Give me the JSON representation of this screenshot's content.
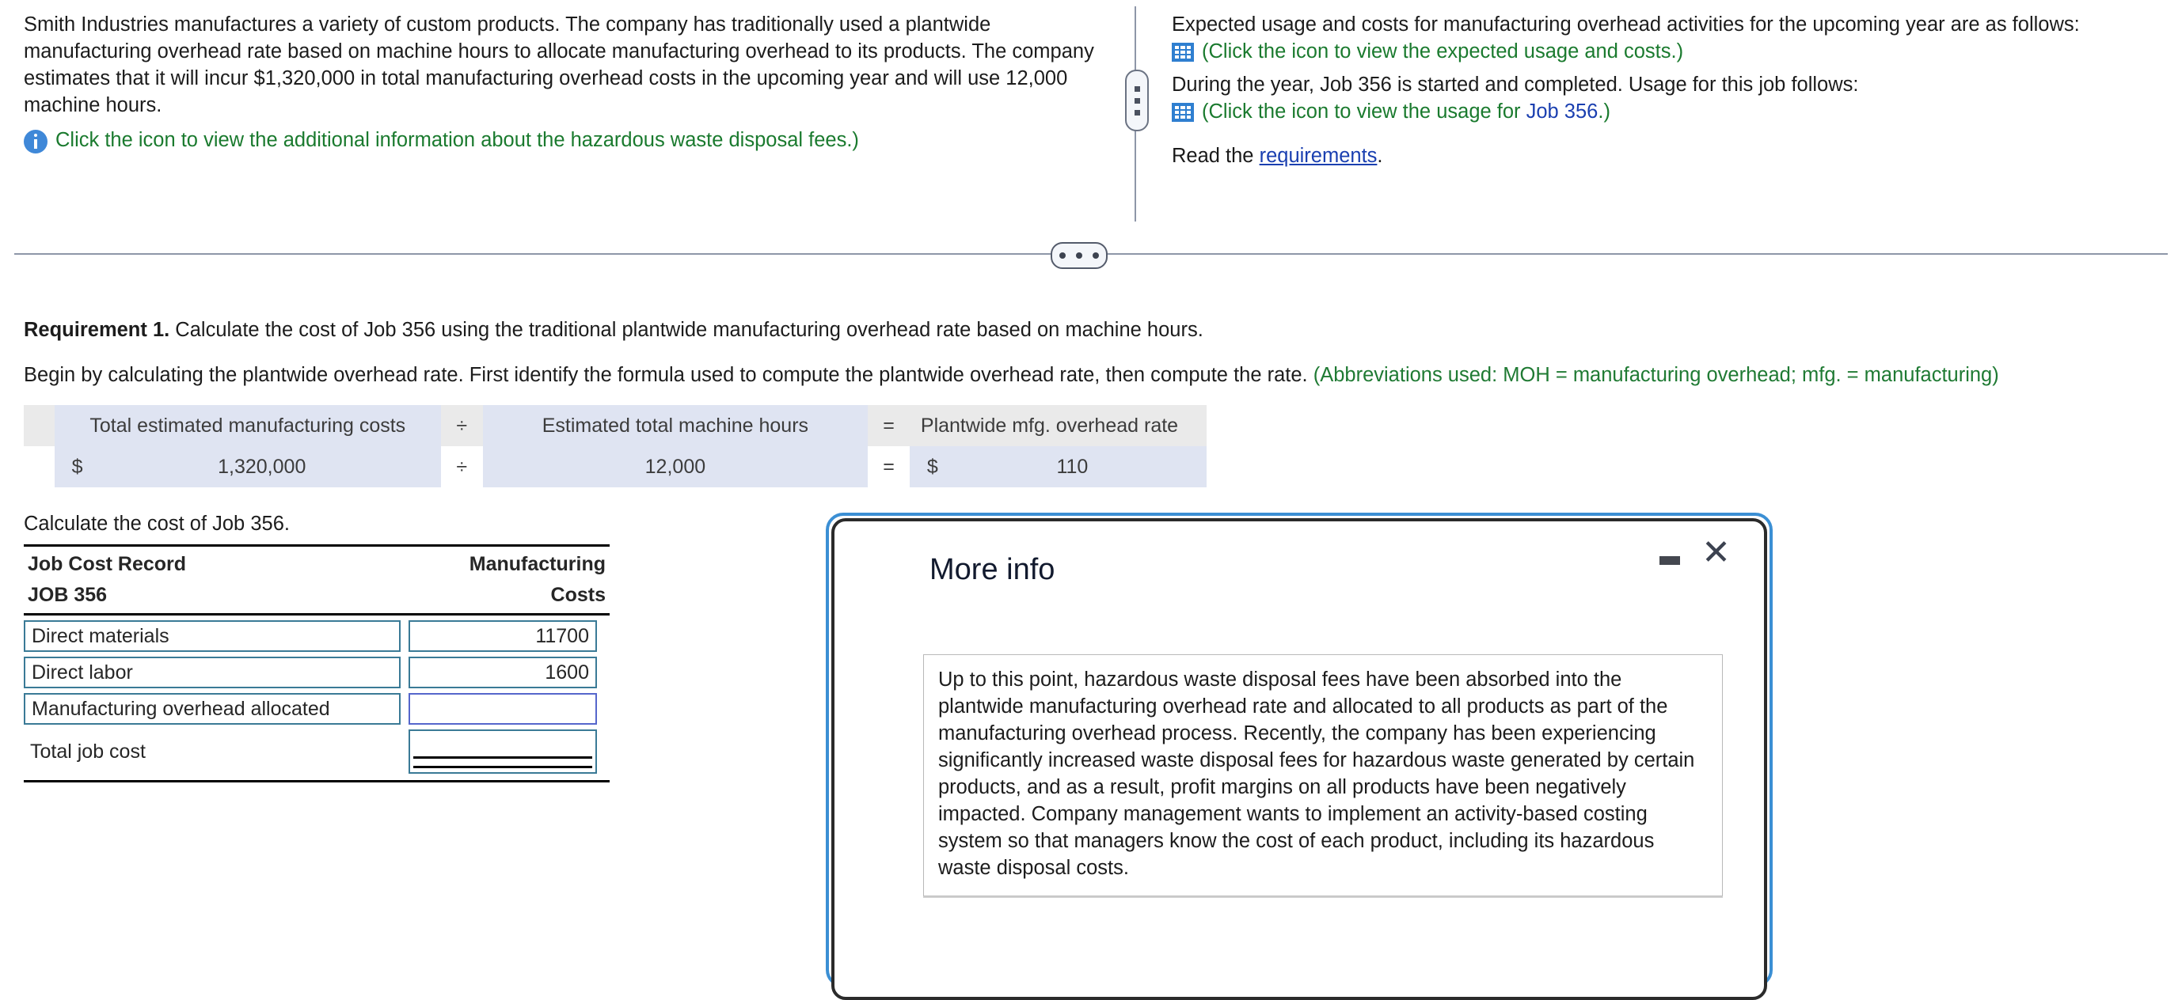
{
  "problem": {
    "left_paragraph": "Smith Industries manufactures a variety of custom products. The company has traditionally used a plantwide manufacturing overhead rate based on machine hours to allocate manufacturing overhead to its products. The company estimates that it will incur $1,320,000 in total manufacturing overhead costs in the upcoming year and will use 12,000 machine hours.",
    "left_icon_link": "Click the icon to view the additional information about the hazardous waste disposal fees.)",
    "right_intro": "Expected usage and costs for manufacturing overhead activities for the upcoming year are as follows:",
    "right_link_1": "(Click the icon to view the expected usage and costs.)",
    "right_mid": "During the year, Job 356 is started and completed. Usage for this job follows:",
    "right_link_2_pre": "(Click the icon to view the usage for ",
    "right_link_2_job": "Job 356",
    "right_link_2_post": ".)",
    "read_the": "Read the ",
    "requirements_link": "requirements",
    "read_period": "."
  },
  "requirement": {
    "label": "Requirement 1.",
    "text": " Calculate the cost of Job 356 using the traditional plantwide manufacturing overhead rate based on machine hours.",
    "begin_text": "Begin by calculating the plantwide overhead rate. First identify the formula used to compute the plantwide overhead rate, then compute the rate. ",
    "abbreviations": "(Abbreviations used: MOH = manufacturing overhead; mfg. = manufacturing)"
  },
  "formula_table": {
    "headers": {
      "col1": "Total estimated manufacturing costs",
      "op1": "÷",
      "col2": "Estimated total machine hours",
      "op2": "=",
      "col3": "Plantwide mfg. overhead rate"
    },
    "values": {
      "c1_symbol": "$",
      "c1_value": "1,320,000",
      "op1": "÷",
      "c2_value": "12,000",
      "op2": "=",
      "c3_symbol": "$",
      "c3_value": "110"
    }
  },
  "job_cost": {
    "instruction": "Calculate the cost of Job 356.",
    "header_left_line1": "Job Cost Record",
    "header_left_line2": "JOB 356",
    "header_right_line1": "Manufacturing",
    "header_right_line2": "Costs",
    "rows": [
      {
        "label": "Direct materials",
        "value": "11700",
        "focused": false
      },
      {
        "label": "Direct labor",
        "value": "1600",
        "focused": false
      },
      {
        "label": "Manufacturing overhead allocated",
        "value": "",
        "focused": true
      }
    ],
    "total_label": "Total job cost",
    "total_value": ""
  },
  "modal": {
    "title": "More info",
    "minimize_label": "",
    "close_label": "✕",
    "body": "Up to this point, hazardous waste disposal fees have been absorbed into the plantwide manufacturing overhead rate and allocated to all products as part of the manufacturing overhead process. Recently, the company has been experiencing significantly increased waste disposal fees for hazardous waste generated by certain products, and as a result, profit margins on all products have been negatively impacted. Company management wants to implement an activity-based costing system so that managers know the cost of each product, including its hazardous waste disposal costs."
  },
  "colors": {
    "green_link": "#1a7a2e",
    "blue_link": "#1a3fb0",
    "modal_border_outer": "#3b8fd4",
    "modal_border_inner": "#2b2b2b",
    "input_border": "#3a7a96",
    "input_border_focused": "#5566cc",
    "table_cell_blue": "#dfe4f2",
    "table_cell_gray": "#eaeaea"
  },
  "icons": {
    "info": "info-icon",
    "grid": "grid-icon",
    "minimize": "minimize-icon",
    "close": "close-icon"
  }
}
